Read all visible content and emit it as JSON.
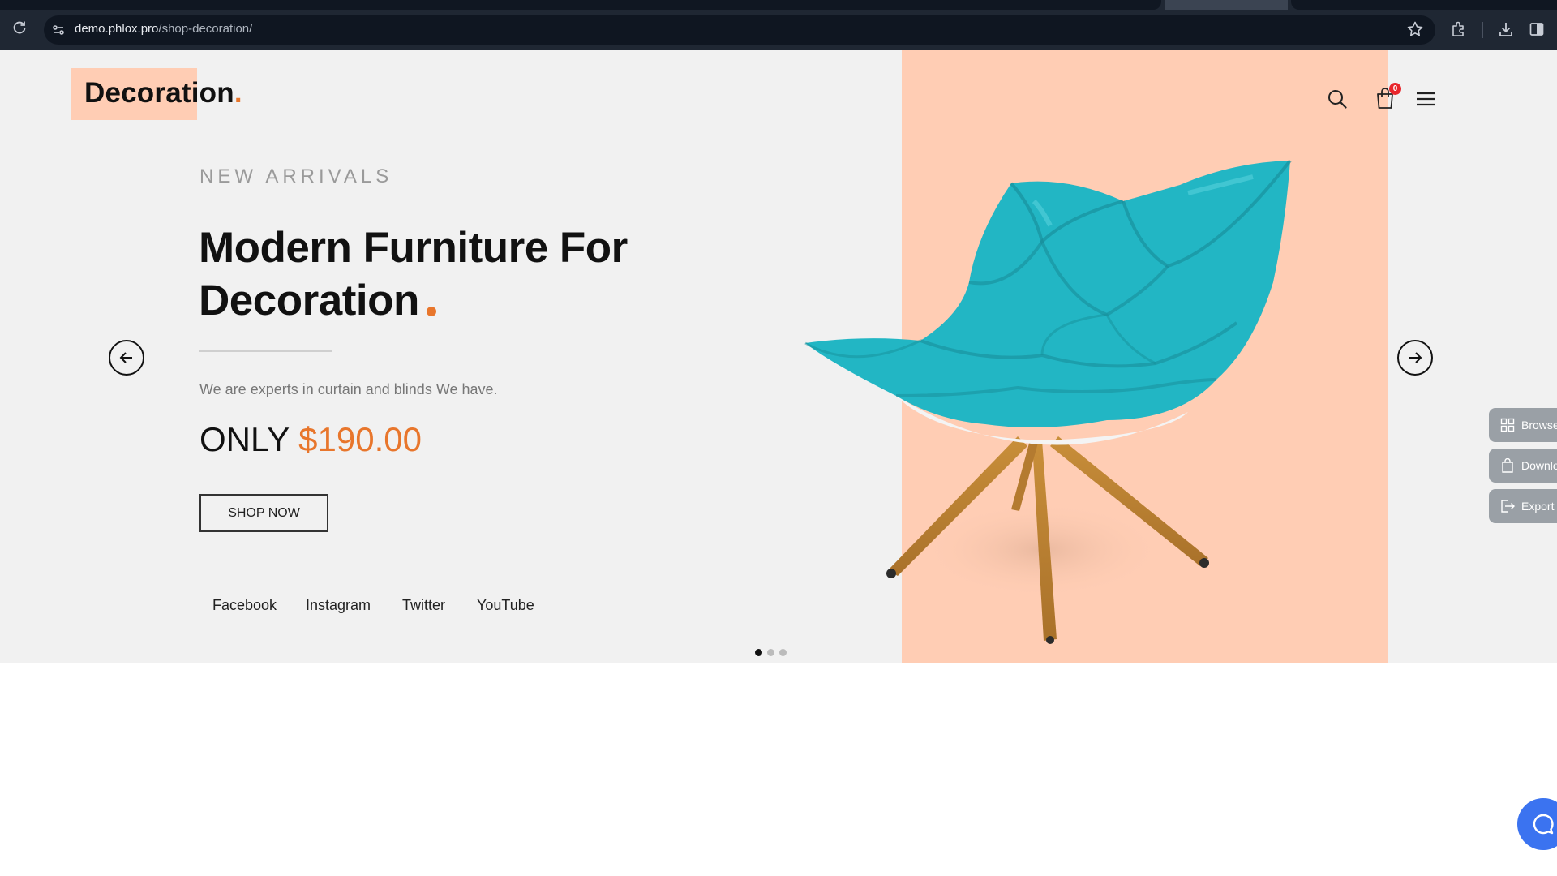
{
  "browser": {
    "url_host": "demo.phlox.pro",
    "url_path": "/shop-decoration/"
  },
  "header": {
    "logo_text": "Decoration",
    "logo_dot": ".",
    "cart_count": "0"
  },
  "hero": {
    "eyebrow": "NEW ARRIVALS",
    "headline_line1": "Modern Furniture For",
    "headline_line2": "Decoration",
    "subtitle": "We are experts in curtain and blinds We have.",
    "price_prefix": "ONLY",
    "price_amount": "$190.00",
    "cta_label": "SHOP NOW",
    "social": [
      "Facebook",
      "Instagram",
      "Twitter",
      "YouTube"
    ],
    "slide_count": 3,
    "active_slide": 1
  },
  "side_tools": [
    "Browse",
    "Downlo",
    "Export S"
  ],
  "colors": {
    "accent": "#e8762c",
    "peach": "#ffcdb4",
    "chair": "#22b6c4",
    "page_bg": "#f1f1f1"
  }
}
